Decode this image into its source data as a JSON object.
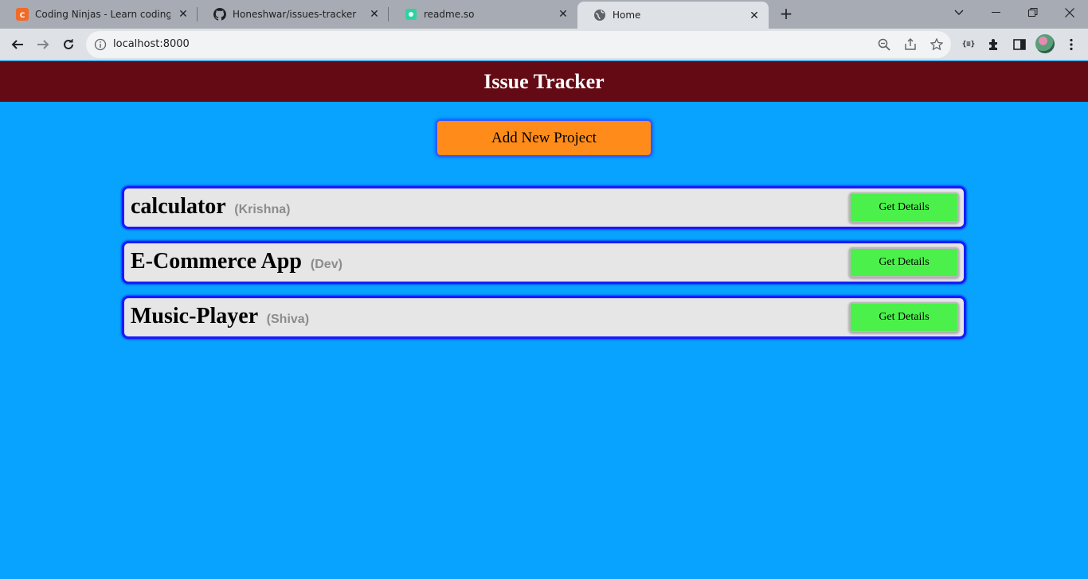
{
  "browser": {
    "tabs": [
      {
        "title": "Coding Ninjas - Learn coding or",
        "icon": "coding-ninjas-icon"
      },
      {
        "title": "Honeshwar/issues-tracker",
        "icon": "github-icon"
      },
      {
        "title": "readme.so",
        "icon": "readme-icon"
      },
      {
        "title": "Home",
        "icon": "globe-icon",
        "active": true
      }
    ],
    "address": "localhost:8000"
  },
  "page": {
    "title": "Issue Tracker",
    "add_button_label": "Add New Project",
    "projects": [
      {
        "name": "calculator",
        "owner": "(Krishna)",
        "button_label": "Get Details"
      },
      {
        "name": "E-Commerce App",
        "owner": "(Dev)",
        "button_label": "Get Details"
      },
      {
        "name": "Music-Player",
        "owner": "(Shiva)",
        "button_label": "Get Details"
      }
    ]
  },
  "colors": {
    "page_background": "#08a3ff",
    "header_background": "#630a14",
    "add_button": "#ff8c1a",
    "details_button": "#4bf04b",
    "card_border": "#1a1aff"
  }
}
